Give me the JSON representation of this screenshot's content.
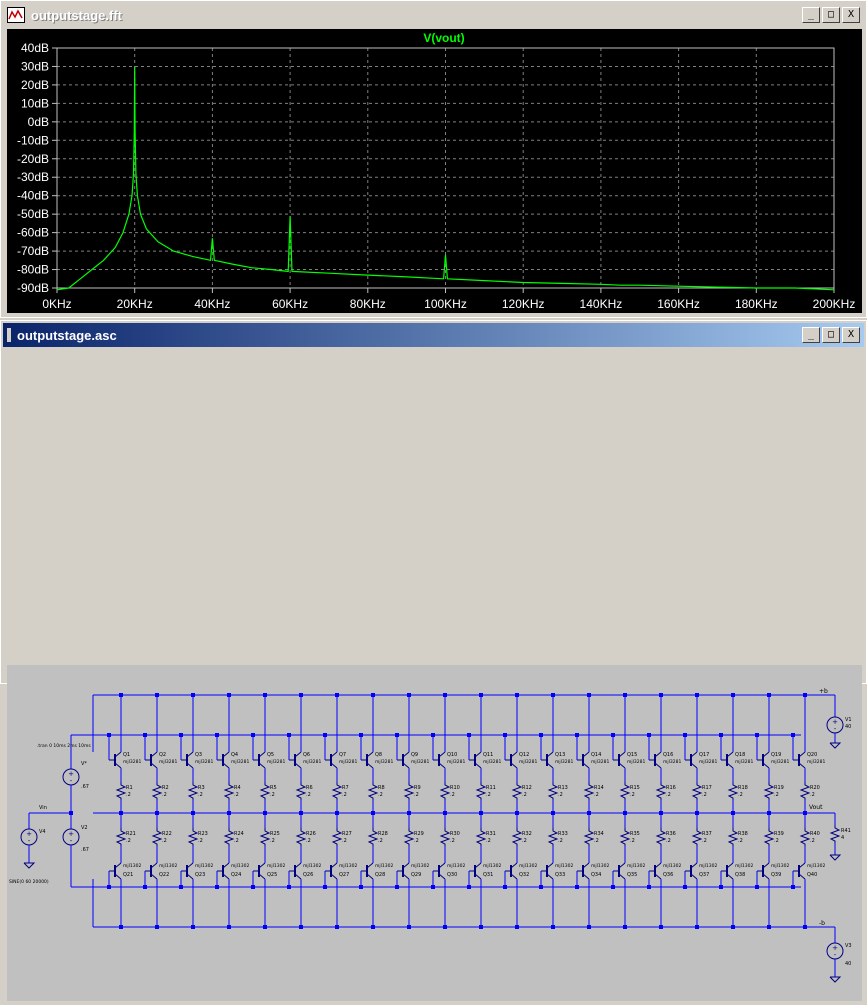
{
  "fft_window": {
    "title": "outputstage.fft",
    "buttons": {
      "minimize": "_",
      "maximize": "□",
      "close": "X"
    },
    "trace_label": "V(vout)",
    "colors": {
      "background": "#000000",
      "trace": "#00ff00",
      "grid": "#808080",
      "axis_text": "#ffffff"
    }
  },
  "schem_window": {
    "title": "outputstage.asc",
    "buttons": {
      "minimize": "_",
      "maximize": "□",
      "close": "X"
    },
    "colors": {
      "background": "#c0c0c0",
      "wire": "#0000ff",
      "component": "#000080"
    }
  },
  "chart_data": {
    "type": "line",
    "title": "V(vout)",
    "xlabel": "",
    "ylabel": "",
    "x_ticks": [
      "0KHz",
      "20KHz",
      "40KHz",
      "60KHz",
      "80KHz",
      "100KHz",
      "120KHz",
      "140KHz",
      "160KHz",
      "180KHz",
      "200KHz"
    ],
    "y_ticks": [
      "40dB",
      "30dB",
      "20dB",
      "10dB",
      "0dB",
      "-10dB",
      "-20dB",
      "-30dB",
      "-40dB",
      "-50dB",
      "-60dB",
      "-70dB",
      "-80dB",
      "-90dB"
    ],
    "xlim": [
      0,
      200
    ],
    "ylim": [
      -90,
      40
    ],
    "x_units": "KHz",
    "y_units": "dB",
    "grid": true,
    "series": [
      {
        "name": "V(vout)",
        "points": [
          [
            0,
            -91
          ],
          [
            3,
            -90
          ],
          [
            6,
            -85
          ],
          [
            9,
            -80
          ],
          [
            12,
            -75
          ],
          [
            15,
            -68
          ],
          [
            17,
            -60
          ],
          [
            18.5,
            -50
          ],
          [
            19.3,
            -40
          ],
          [
            19.7,
            -28
          ],
          [
            19.9,
            -5
          ],
          [
            20,
            30
          ],
          [
            20.1,
            -5
          ],
          [
            20.3,
            -28
          ],
          [
            20.7,
            -40
          ],
          [
            21.5,
            -50
          ],
          [
            23,
            -58
          ],
          [
            26,
            -65
          ],
          [
            30,
            -70
          ],
          [
            35,
            -73
          ],
          [
            39.5,
            -75
          ],
          [
            40,
            -63
          ],
          [
            40.5,
            -75
          ],
          [
            45,
            -77
          ],
          [
            50,
            -79
          ],
          [
            55,
            -80
          ],
          [
            59.5,
            -81
          ],
          [
            60,
            -51
          ],
          [
            60.5,
            -81
          ],
          [
            70,
            -82
          ],
          [
            80,
            -83
          ],
          [
            90,
            -84
          ],
          [
            99.5,
            -85
          ],
          [
            100,
            -72
          ],
          [
            100.5,
            -85
          ],
          [
            110,
            -86
          ],
          [
            120,
            -87
          ],
          [
            130,
            -87.5
          ],
          [
            140,
            -88
          ],
          [
            145,
            -88.5
          ],
          [
            150,
            -88.5
          ],
          [
            160,
            -89
          ],
          [
            170,
            -89.5
          ],
          [
            180,
            -90
          ],
          [
            190,
            -90
          ],
          [
            200,
            -91
          ]
        ]
      }
    ]
  },
  "schematic": {
    "stages": 20,
    "upper_q_labels": [
      "Q1",
      "Q2",
      "Q3",
      "Q4",
      "Q5",
      "Q6",
      "Q7",
      "Q8",
      "Q9",
      "Q10",
      "Q11",
      "Q12",
      "Q13",
      "Q14",
      "Q15",
      "Q16",
      "Q17",
      "Q18",
      "Q19",
      "Q20"
    ],
    "lower_q_labels": [
      "Q21",
      "Q22",
      "Q23",
      "Q24",
      "Q25",
      "Q26",
      "Q27",
      "Q28",
      "Q29",
      "Q30",
      "Q31",
      "Q32",
      "Q33",
      "Q34",
      "Q35",
      "Q36",
      "Q37",
      "Q38",
      "Q39",
      "Q40"
    ],
    "upper_r_labels": [
      "R1",
      "R2",
      "R3",
      "R4",
      "R5",
      "R6",
      "R7",
      "R8",
      "R9",
      "R10",
      "R11",
      "R12",
      "R13",
      "R14",
      "R15",
      "R16",
      "R17",
      "R18",
      "R19",
      "R20"
    ],
    "lower_r_labels": [
      "R21",
      "R22",
      "R23",
      "R24",
      "R25",
      "R26",
      "R27",
      "R28",
      "R29",
      "R30",
      "R31",
      "R32",
      "R33",
      "R34",
      "R35",
      "R36",
      "R37",
      "R38",
      "R39",
      "R40"
    ],
    "upper_model": "mjl3281",
    "lower_model": "mjl1302",
    "r_value": ".2",
    "nodes": {
      "pos_rail": "+b",
      "neg_rail": "-b",
      "vout": "Vout",
      "vin": "Vin"
    },
    "supplies": {
      "v1_label": "V1",
      "v1_value": "40",
      "v2_label": "V2",
      "v2_value": ".67",
      "v3_label": "V3",
      "v3_value": "40",
      "v4_label": "V4",
      "v4_value": "SINE(0 60 20000)",
      "vb1_label": "V*",
      "vb1_value": ".67"
    },
    "load": {
      "label": "R41",
      "value": "4"
    },
    "directive": ".tran 0 10ms 2ms 10ms"
  }
}
